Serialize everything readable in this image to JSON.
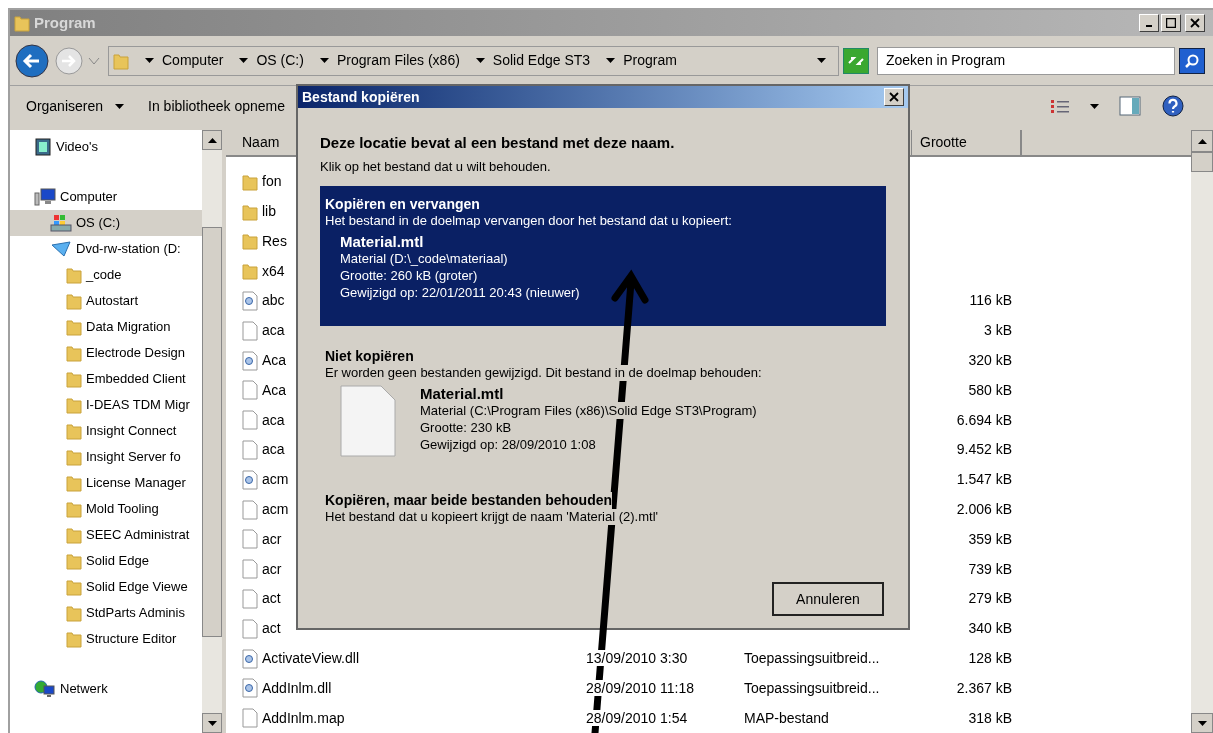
{
  "window": {
    "title": "Program"
  },
  "address": {
    "crumbs": [
      "Computer",
      "OS (C:)",
      "Program Files (x86)",
      "Solid Edge ST3",
      "Program"
    ]
  },
  "search": {
    "placeholder": "Zoeken in Program"
  },
  "toolbar": {
    "items": [
      "Organiseren",
      "In bibliotheek opneme"
    ]
  },
  "sidebar": {
    "items": [
      {
        "label": "Video's",
        "kind": "video",
        "selected": false
      },
      {
        "label": "Computer",
        "kind": "computer",
        "selected": false,
        "children": [
          {
            "label": "OS (C:)",
            "kind": "drive",
            "selected": true
          },
          {
            "label": "Dvd-rw-station (D:",
            "kind": "dvd",
            "selected": false,
            "children": [
              {
                "label": "_code",
                "kind": "folder",
                "selected": false
              },
              {
                "label": "Autostart",
                "kind": "folder",
                "selected": false
              },
              {
                "label": "Data Migration",
                "kind": "folder",
                "selected": false
              },
              {
                "label": "Electrode Design",
                "kind": "folder",
                "selected": false
              },
              {
                "label": "Embedded Client",
                "kind": "folder",
                "selected": false
              },
              {
                "label": "I-DEAS TDM Migr",
                "kind": "folder",
                "selected": false
              },
              {
                "label": "Insight Connect",
                "kind": "folder",
                "selected": false
              },
              {
                "label": "Insight Server fo",
                "kind": "folder",
                "selected": false
              },
              {
                "label": "License Manager",
                "kind": "folder",
                "selected": false
              },
              {
                "label": "Mold Tooling",
                "kind": "folder",
                "selected": false
              },
              {
                "label": "SEEC Administrat",
                "kind": "folder",
                "selected": false
              },
              {
                "label": "Solid Edge",
                "kind": "folder",
                "selected": false
              },
              {
                "label": "Solid Edge Viewe",
                "kind": "folder",
                "selected": false
              },
              {
                "label": "StdParts Adminis",
                "kind": "folder",
                "selected": false
              },
              {
                "label": "Structure Editor",
                "kind": "folder",
                "selected": false
              }
            ]
          }
        ]
      },
      {
        "label": "Netwerk",
        "kind": "network",
        "selected": false
      }
    ]
  },
  "table": {
    "columns": [
      "Naam",
      "Grootte"
    ],
    "rows": [
      {
        "kind": "folder",
        "name": "fon"
      },
      {
        "kind": "folder",
        "name": "lib"
      },
      {
        "kind": "folder",
        "name": "Res"
      },
      {
        "kind": "folder",
        "name": "x64"
      },
      {
        "kind": "dll",
        "name": "abc",
        "size": "116 kB"
      },
      {
        "kind": "file",
        "name": "aca",
        "size": "3 kB"
      },
      {
        "kind": "dll",
        "name": "Aca",
        "size": "320 kB"
      },
      {
        "kind": "file",
        "name": "Aca",
        "size": "580 kB"
      },
      {
        "kind": "file",
        "name": "aca",
        "size": "6.694 kB"
      },
      {
        "kind": "file",
        "name": "aca",
        "size": "9.452 kB"
      },
      {
        "kind": "dll",
        "name": "acm",
        "size": "1.547 kB"
      },
      {
        "kind": "file",
        "name": "acm",
        "size": "2.006 kB"
      },
      {
        "kind": "file",
        "name": "acr",
        "size": "359 kB"
      },
      {
        "kind": "file",
        "name": "acr",
        "size": "739 kB"
      },
      {
        "kind": "file",
        "name": "act",
        "size": "279 kB"
      },
      {
        "kind": "file",
        "name": "act",
        "size": "340 kB"
      },
      {
        "kind": "dll",
        "name": "ActivateView.dll",
        "date": "13/09/2010 3:30",
        "type": "Toepassingsuitbreid...",
        "size": "128 kB"
      },
      {
        "kind": "dll",
        "name": "AddInlm.dll",
        "date": "28/09/2010 11:18",
        "type": "Toepassingsuitbreid...",
        "size": "2.367 kB"
      },
      {
        "kind": "file",
        "name": "AddInlm.map",
        "date": "28/09/2010 1:54",
        "type": "MAP-bestand",
        "size": "318 kB"
      }
    ]
  },
  "dialog": {
    "title": "Bestand kopiëren",
    "heading": "Deze locatie bevat al een bestand met deze naam.",
    "subheading": "Klik op het bestand dat u wilt behouden.",
    "options": [
      {
        "title": "Kopiëren en vervangen",
        "description": "Het bestand in de doelmap vervangen door het bestand dat u kopieert:",
        "selected": true,
        "file": {
          "name": "Material.mtl",
          "lines": [
            "Material (D:\\_code\\materiaal)",
            "Grootte: 260 kB (groter)",
            "Gewijzigd op: 22/01/2011 20:43 (nieuwer)"
          ],
          "icon": false
        }
      },
      {
        "title": "Niet kopiëren",
        "description": "Er worden geen bestanden gewijzigd. Dit bestand in de doelmap behouden:",
        "selected": false,
        "file": {
          "name": "Material.mtl",
          "lines": [
            "Material (C:\\Program Files (x86)\\Solid Edge ST3\\Program)",
            "Grootte: 230 kB",
            "Gewijzigd op: 28/09/2010 1:08"
          ],
          "icon": true
        }
      },
      {
        "title": "Kopiëren, maar beide bestanden behouden",
        "description": "Het bestand dat u kopieert krijgt de naam 'Material (2).mtl'",
        "selected": false
      }
    ],
    "cancel": "Annuleren"
  }
}
